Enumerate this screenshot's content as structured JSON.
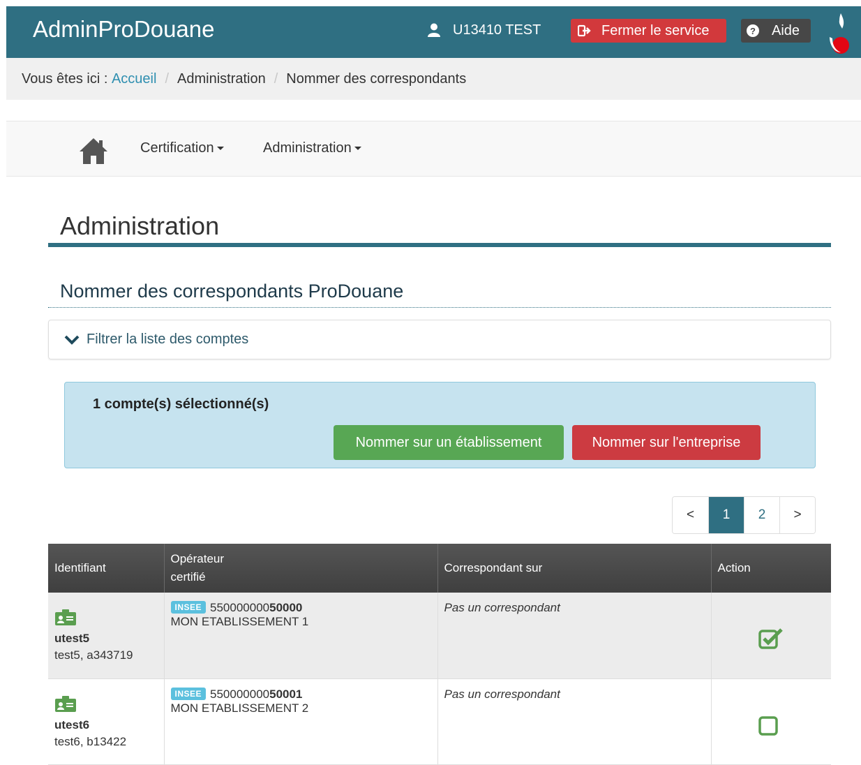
{
  "header": {
    "app_title": "AdminProDouane",
    "user": "U13410 TEST",
    "close_label": "Fermer le service",
    "help_label": "Aide"
  },
  "breadcrumb": {
    "prefix": "Vous êtes ici :",
    "items": [
      "Accueil",
      "Administration",
      "Nommer des correspondants"
    ]
  },
  "nav": {
    "items": [
      "Certification",
      "Administration"
    ]
  },
  "page": {
    "title": "Administration",
    "subtitle": "Nommer des correspondants ProDouane",
    "filter_label": "Filtrer la liste des comptes"
  },
  "selection": {
    "count_text": "1 compte(s) sélectionné(s)",
    "btn_establishment": "Nommer sur un établissement",
    "btn_company": "Nommer sur l'entreprise"
  },
  "pagination": {
    "prev": "<",
    "pages": [
      "1",
      "2"
    ],
    "current": "1",
    "next": ">"
  },
  "table": {
    "headers": [
      "Identifiant",
      "Opérateur\ncertifié",
      "Correspondant sur",
      "Action"
    ],
    "rows": [
      {
        "user_id": "utest5",
        "user_meta": "test5, a343719",
        "badge": "INSEE",
        "siret_prefix": "550000000",
        "siret_suffix": "50000",
        "establishment": "MON ETABLISSEMENT 1",
        "correspondent": "Pas un correspondant",
        "checked": true
      },
      {
        "user_id": "utest6",
        "user_meta": "test6, b13422",
        "badge": "INSEE",
        "siret_prefix": "550000000",
        "siret_suffix": "50001",
        "establishment": "MON ETABLISSEMENT 2",
        "correspondent": "Pas un correspondant",
        "checked": false
      }
    ]
  },
  "colors": {
    "brand": "#2f6f82",
    "danger": "#d2393c",
    "success": "#58a754",
    "info_bg": "#c6e3ef",
    "id_icon": "#5a9e4f"
  },
  "icons": {
    "user": "user-icon",
    "close": "sign-out-icon",
    "help": "question-circle-icon",
    "home": "home-icon",
    "filter": "chevron-down-icon",
    "id_card": "id-card-icon",
    "checked": "checkbox-checked-icon",
    "unchecked": "checkbox-unchecked-icon"
  }
}
